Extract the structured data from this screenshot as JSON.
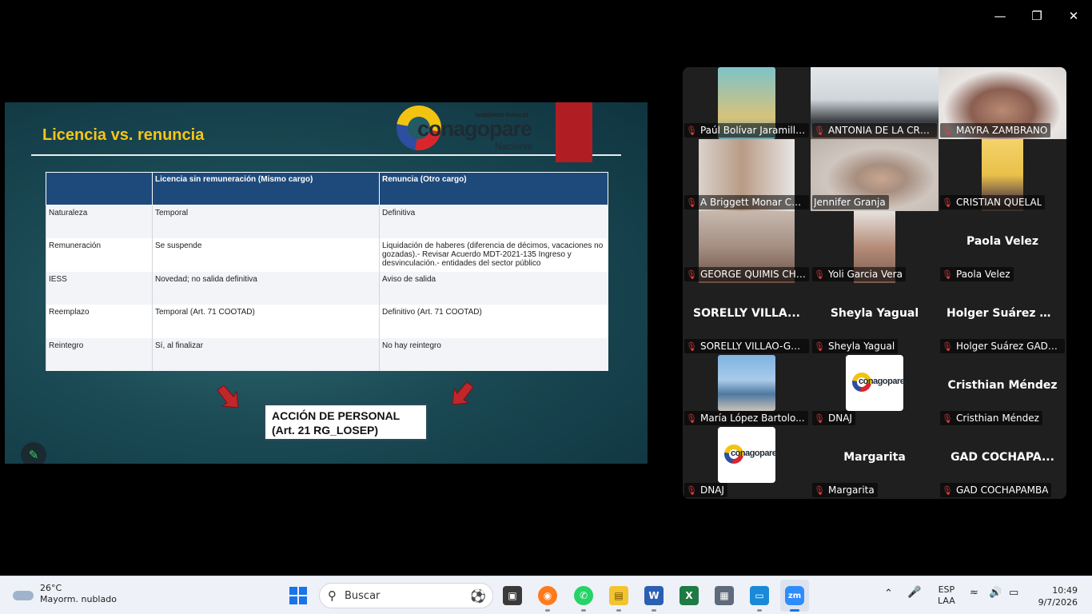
{
  "window": {
    "minimize_icon": "minimize-icon",
    "restore_icon": "restore-icon",
    "close_icon": "close-icon"
  },
  "slide": {
    "title": "Licencia vs. renuncia",
    "logo": {
      "top_text": "GOBIERNOS RURALES",
      "word": "conagopare",
      "sub": "Nacional"
    },
    "table": {
      "headers": [
        "",
        "Licencia sin remuneración (Mismo cargo)",
        "Renuncia (Otro cargo)"
      ],
      "rows": [
        [
          "Naturaleza",
          "Temporal",
          "Definitiva"
        ],
        [
          "Remuneración",
          "Se suspende",
          "Liquidación de haberes (diferencia de décimos, vacaciones no gozadas).- Revisar Acuerdo MDT-2021-135 Ingreso y desvinculación.- entidades del sector público"
        ],
        [
          "IESS",
          "Novedad; no salida definitiva",
          "Aviso de salida"
        ],
        [
          "Reemplazo",
          "Temporal (Art. 71 COOTAD)",
          "Definitivo (Art. 71 COOTAD)"
        ],
        [
          "Reintegro",
          "Sí, al finalizar",
          "No hay reintegro"
        ]
      ]
    },
    "action_line1": "ACCIÓN DE PERSONAL",
    "action_line2": "(Art. 21 RG_LOSEP)",
    "annotate_icon": "pencil-icon"
  },
  "participants": [
    {
      "name": "Paúl Bolívar Jaramillo..."
    },
    {
      "name": "ANTONIA DE LA CRU..."
    },
    {
      "name": "MAYRA ZAMBRANO"
    },
    {
      "name": "A Briggett Monar Col..."
    },
    {
      "name": "Jennifer Granja"
    },
    {
      "name": "CRISTIAN QUELAL"
    },
    {
      "name": "GEORGE QUIMIS CHI..."
    },
    {
      "name": "Yoli Garcia Vera"
    },
    {
      "name": "Paola Velez",
      "display": "Paola Velez"
    },
    {
      "name": "SORELLY VILLAO-GAD...",
      "display": "SORELLY VILLA..."
    },
    {
      "name": "Sheyla Yagual",
      "display": "Sheyla Yagual"
    },
    {
      "name": "Holger Suárez GADP ...",
      "display": "Holger Suárez G..."
    },
    {
      "name": "María López Bartolo..."
    },
    {
      "name": "DNAJ"
    },
    {
      "name": "Cristhian Méndez",
      "display": "Cristhian Méndez"
    },
    {
      "name": "DNAJ"
    },
    {
      "name": "Margarita",
      "display": "Margarita"
    },
    {
      "name": "GAD COCHAPAMBA",
      "display": "GAD COCHAPA..."
    }
  ],
  "taskbar": {
    "weather_temp": "26°C",
    "weather_desc": "Mayorm. nublado",
    "search_placeholder": "Buscar",
    "lang_line1": "ESP",
    "lang_line2": "LAA",
    "time": "10:49",
    "date": "9/7/2026"
  },
  "colors": {
    "accent_green": "#3ecf6b",
    "mic_red": "#e43b3b",
    "slide_title": "#f5c518",
    "header_blue": "#1d4a7a"
  }
}
